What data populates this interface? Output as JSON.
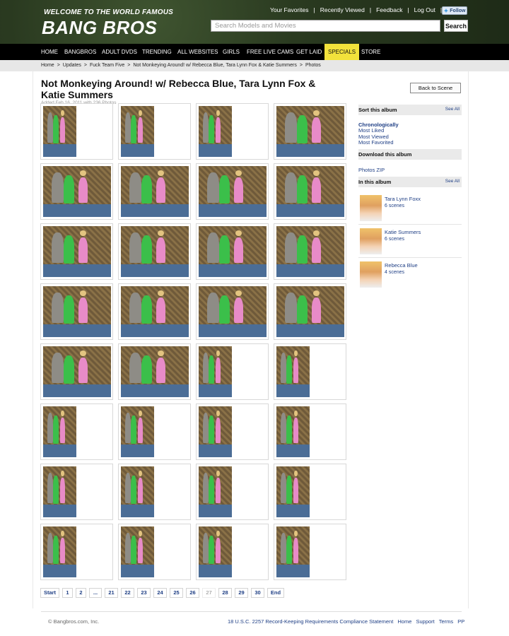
{
  "header": {
    "tagline": "WELCOME TO THE WORLD FAMOUS",
    "logo": "BANG BROS",
    "top_links": [
      "Your Favorites",
      "Recently Viewed",
      "Feedback",
      "Log Out"
    ],
    "follow_label": "Follow",
    "search_placeholder": "Search Models and Movies",
    "search_button": "Search"
  },
  "nav": {
    "items": [
      "HOME",
      "BANGBROS",
      "ADULT DVDS",
      "TRENDING",
      "ALL WEBSITES",
      "GIRLS",
      "FREE LIVE CAMS",
      "GET LAID",
      "SPECIALS",
      "STORE"
    ],
    "active": "SPECIALS",
    "active_color": "#f2e23b"
  },
  "breadcrumb": [
    "Home",
    "Updates",
    "Fuck Team Five",
    "Not Monkeying Around! w/ Rebecca Blue, Tara Lynn Fox & Katie Summers",
    "Photos"
  ],
  "page": {
    "title": "Not Monkeying Around! w/ Rebecca Blue, Tara Lynn Fox & Katie Summers",
    "added_info": "Added Feb 16, 2011 with 236 Photos",
    "back_button": "Back to Scene"
  },
  "gallery": {
    "orientations": [
      "port",
      "port",
      "port",
      "land",
      "land",
      "land",
      "land",
      "land",
      "land",
      "land",
      "land",
      "land",
      "land",
      "land",
      "land",
      "land",
      "land",
      "land",
      "port",
      "port",
      "port",
      "port",
      "port",
      "port",
      "port",
      "port",
      "port",
      "port",
      "port",
      "port",
      "port",
      "port"
    ]
  },
  "sidebar": {
    "sort_title": "Sort this album",
    "see_all": "See All",
    "sort_options": [
      "Chronologically",
      "Most Liked",
      "Most Viewed",
      "Most Favorited"
    ],
    "sort_selected": "Chronologically",
    "download_title": "Download this album",
    "download_link": "Photos ZIP",
    "album_title": "In this album",
    "performers": [
      {
        "name": "Tara Lynn Foxx",
        "scenes": "6 scenes"
      },
      {
        "name": "Katie Summers",
        "scenes": "6 scenes"
      },
      {
        "name": "Rebecca Blue",
        "scenes": "4 scenes"
      }
    ]
  },
  "pagination": {
    "items": [
      "Start",
      "1",
      "2",
      "...",
      "21",
      "22",
      "23",
      "24",
      "25",
      "26",
      "27",
      "28",
      "29",
      "30",
      "End"
    ],
    "current": "27"
  },
  "footer": {
    "copyright": "© Bangbros.com, Inc.",
    "links": [
      "18 U.S.C. 2257 Record-Keeping Requirements Compliance Statement",
      "Home",
      "Support",
      "Terms",
      "PP"
    ]
  },
  "colors": {
    "header_bg": "#2b3a22",
    "nav_bg": "#000000",
    "link_blue": "#1f3f85"
  }
}
